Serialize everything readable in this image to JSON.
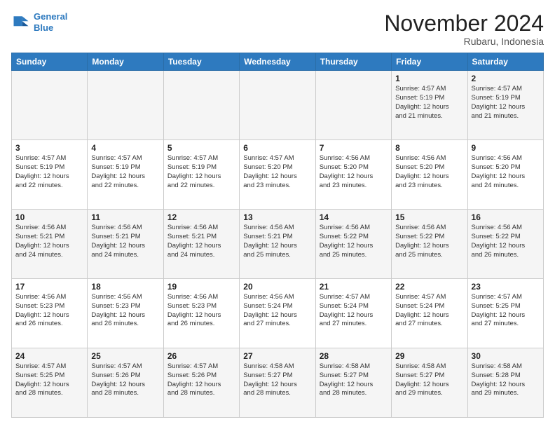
{
  "header": {
    "logo_line1": "General",
    "logo_line2": "Blue",
    "month": "November 2024",
    "location": "Rubaru, Indonesia"
  },
  "weekdays": [
    "Sunday",
    "Monday",
    "Tuesday",
    "Wednesday",
    "Thursday",
    "Friday",
    "Saturday"
  ],
  "weeks": [
    [
      {
        "day": "",
        "info": ""
      },
      {
        "day": "",
        "info": ""
      },
      {
        "day": "",
        "info": ""
      },
      {
        "day": "",
        "info": ""
      },
      {
        "day": "",
        "info": ""
      },
      {
        "day": "1",
        "info": "Sunrise: 4:57 AM\nSunset: 5:19 PM\nDaylight: 12 hours\nand 21 minutes."
      },
      {
        "day": "2",
        "info": "Sunrise: 4:57 AM\nSunset: 5:19 PM\nDaylight: 12 hours\nand 21 minutes."
      }
    ],
    [
      {
        "day": "3",
        "info": "Sunrise: 4:57 AM\nSunset: 5:19 PM\nDaylight: 12 hours\nand 22 minutes."
      },
      {
        "day": "4",
        "info": "Sunrise: 4:57 AM\nSunset: 5:19 PM\nDaylight: 12 hours\nand 22 minutes."
      },
      {
        "day": "5",
        "info": "Sunrise: 4:57 AM\nSunset: 5:19 PM\nDaylight: 12 hours\nand 22 minutes."
      },
      {
        "day": "6",
        "info": "Sunrise: 4:57 AM\nSunset: 5:20 PM\nDaylight: 12 hours\nand 23 minutes."
      },
      {
        "day": "7",
        "info": "Sunrise: 4:56 AM\nSunset: 5:20 PM\nDaylight: 12 hours\nand 23 minutes."
      },
      {
        "day": "8",
        "info": "Sunrise: 4:56 AM\nSunset: 5:20 PM\nDaylight: 12 hours\nand 23 minutes."
      },
      {
        "day": "9",
        "info": "Sunrise: 4:56 AM\nSunset: 5:20 PM\nDaylight: 12 hours\nand 24 minutes."
      }
    ],
    [
      {
        "day": "10",
        "info": "Sunrise: 4:56 AM\nSunset: 5:21 PM\nDaylight: 12 hours\nand 24 minutes."
      },
      {
        "day": "11",
        "info": "Sunrise: 4:56 AM\nSunset: 5:21 PM\nDaylight: 12 hours\nand 24 minutes."
      },
      {
        "day": "12",
        "info": "Sunrise: 4:56 AM\nSunset: 5:21 PM\nDaylight: 12 hours\nand 24 minutes."
      },
      {
        "day": "13",
        "info": "Sunrise: 4:56 AM\nSunset: 5:21 PM\nDaylight: 12 hours\nand 25 minutes."
      },
      {
        "day": "14",
        "info": "Sunrise: 4:56 AM\nSunset: 5:22 PM\nDaylight: 12 hours\nand 25 minutes."
      },
      {
        "day": "15",
        "info": "Sunrise: 4:56 AM\nSunset: 5:22 PM\nDaylight: 12 hours\nand 25 minutes."
      },
      {
        "day": "16",
        "info": "Sunrise: 4:56 AM\nSunset: 5:22 PM\nDaylight: 12 hours\nand 26 minutes."
      }
    ],
    [
      {
        "day": "17",
        "info": "Sunrise: 4:56 AM\nSunset: 5:23 PM\nDaylight: 12 hours\nand 26 minutes."
      },
      {
        "day": "18",
        "info": "Sunrise: 4:56 AM\nSunset: 5:23 PM\nDaylight: 12 hours\nand 26 minutes."
      },
      {
        "day": "19",
        "info": "Sunrise: 4:56 AM\nSunset: 5:23 PM\nDaylight: 12 hours\nand 26 minutes."
      },
      {
        "day": "20",
        "info": "Sunrise: 4:56 AM\nSunset: 5:24 PM\nDaylight: 12 hours\nand 27 minutes."
      },
      {
        "day": "21",
        "info": "Sunrise: 4:57 AM\nSunset: 5:24 PM\nDaylight: 12 hours\nand 27 minutes."
      },
      {
        "day": "22",
        "info": "Sunrise: 4:57 AM\nSunset: 5:24 PM\nDaylight: 12 hours\nand 27 minutes."
      },
      {
        "day": "23",
        "info": "Sunrise: 4:57 AM\nSunset: 5:25 PM\nDaylight: 12 hours\nand 27 minutes."
      }
    ],
    [
      {
        "day": "24",
        "info": "Sunrise: 4:57 AM\nSunset: 5:25 PM\nDaylight: 12 hours\nand 28 minutes."
      },
      {
        "day": "25",
        "info": "Sunrise: 4:57 AM\nSunset: 5:26 PM\nDaylight: 12 hours\nand 28 minutes."
      },
      {
        "day": "26",
        "info": "Sunrise: 4:57 AM\nSunset: 5:26 PM\nDaylight: 12 hours\nand 28 minutes."
      },
      {
        "day": "27",
        "info": "Sunrise: 4:58 AM\nSunset: 5:27 PM\nDaylight: 12 hours\nand 28 minutes."
      },
      {
        "day": "28",
        "info": "Sunrise: 4:58 AM\nSunset: 5:27 PM\nDaylight: 12 hours\nand 28 minutes."
      },
      {
        "day": "29",
        "info": "Sunrise: 4:58 AM\nSunset: 5:27 PM\nDaylight: 12 hours\nand 29 minutes."
      },
      {
        "day": "30",
        "info": "Sunrise: 4:58 AM\nSunset: 5:28 PM\nDaylight: 12 hours\nand 29 minutes."
      }
    ]
  ]
}
